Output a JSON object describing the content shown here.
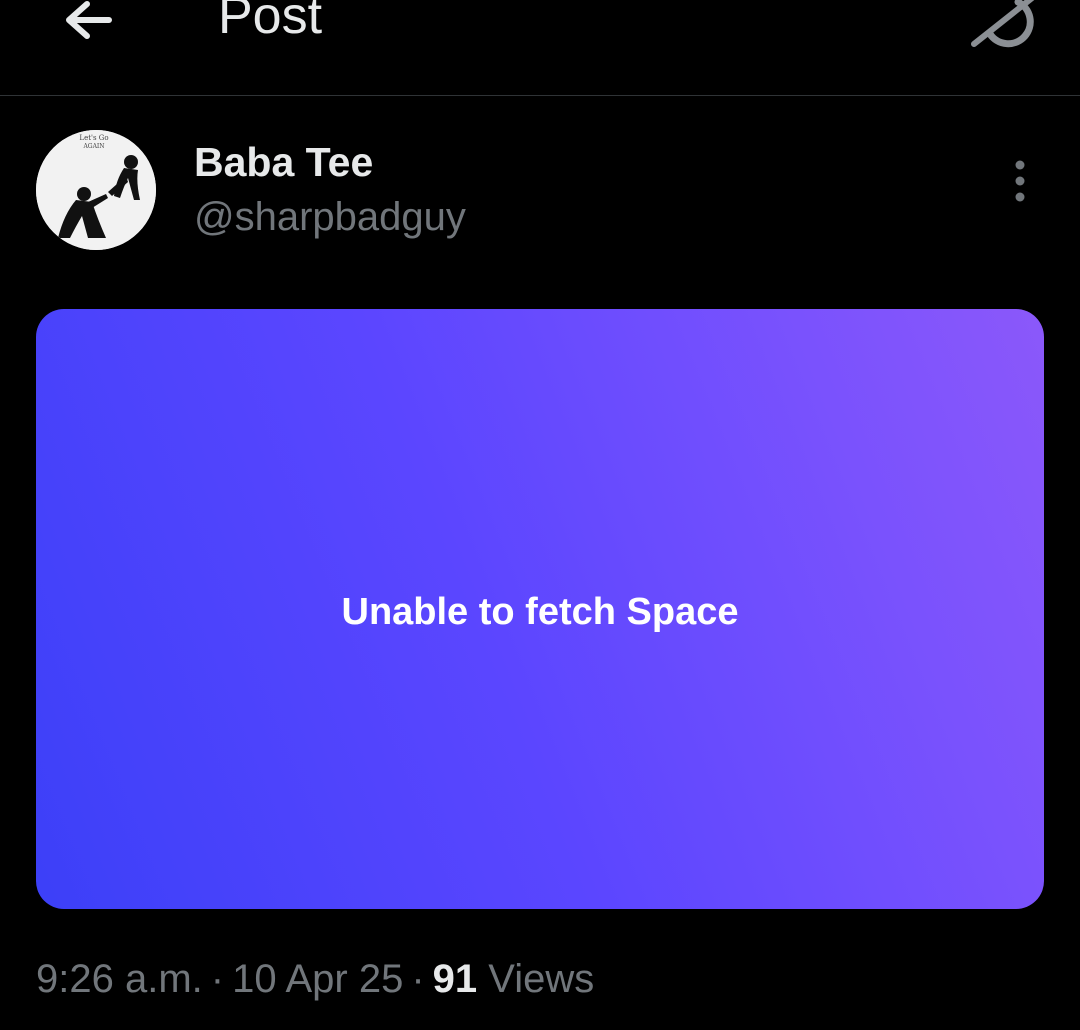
{
  "header": {
    "title": "Post",
    "back_icon": "arrow-left-icon",
    "grok_icon": "grok-icon"
  },
  "post": {
    "author": {
      "display_name": "Baba Tee",
      "handle": "@sharpbadguy",
      "avatar_caption": "Let's Go",
      "avatar_caption_2": "AGAIN"
    },
    "more_icon": "more-vertical-icon",
    "space_card": {
      "message": "Unable to fetch Space",
      "gradient_start": "#3c40f8",
      "gradient_end": "#8b58fa"
    },
    "meta": {
      "time": "9:26 a.m.",
      "separator": "·",
      "date": "10 Apr 25",
      "views_count": "91",
      "views_label": "Views"
    }
  }
}
